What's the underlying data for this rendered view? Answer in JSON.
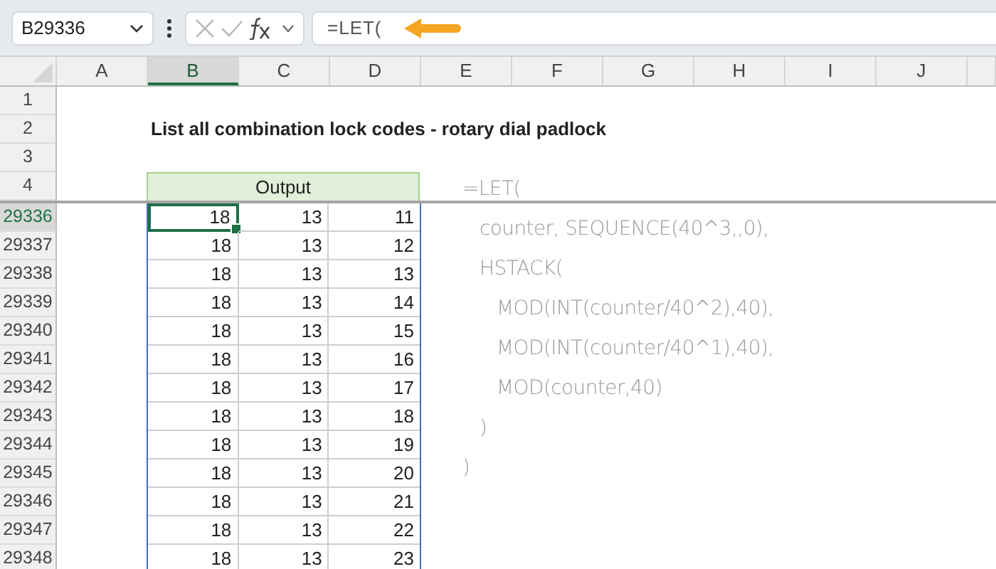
{
  "toolbar": {
    "name_box": "B29336",
    "formula": "=LET("
  },
  "columns": [
    {
      "label": "A",
      "selected": false
    },
    {
      "label": "B",
      "selected": true
    },
    {
      "label": "C",
      "selected": false
    },
    {
      "label": "D",
      "selected": false
    },
    {
      "label": "E",
      "selected": false
    },
    {
      "label": "F",
      "selected": false
    },
    {
      "label": "G",
      "selected": false
    },
    {
      "label": "H",
      "selected": false
    },
    {
      "label": "I",
      "selected": false
    },
    {
      "label": "J",
      "selected": false
    }
  ],
  "sheet_rows": [
    {
      "kind": "blank",
      "header": "1",
      "selected": false
    },
    {
      "kind": "title",
      "header": "2",
      "selected": false,
      "text": "List all combination lock codes - rotary dial padlock"
    },
    {
      "kind": "blank",
      "header": "3",
      "selected": false
    },
    {
      "kind": "header",
      "header": "4",
      "selected": false,
      "text": "Output"
    },
    {
      "kind": "data",
      "header": "29336",
      "selected": true,
      "cells": [
        {
          "text": "18",
          "selected": true
        },
        {
          "text": "13",
          "selected": false
        },
        {
          "text": "11",
          "selected": false
        }
      ]
    },
    {
      "kind": "data",
      "header": "29337",
      "selected": false,
      "cells": [
        {
          "text": "18",
          "selected": false
        },
        {
          "text": "13",
          "selected": false
        },
        {
          "text": "12",
          "selected": false
        }
      ]
    },
    {
      "kind": "data",
      "header": "29338",
      "selected": false,
      "cells": [
        {
          "text": "18",
          "selected": false
        },
        {
          "text": "13",
          "selected": false
        },
        {
          "text": "13",
          "selected": false
        }
      ]
    },
    {
      "kind": "data",
      "header": "29339",
      "selected": false,
      "cells": [
        {
          "text": "18",
          "selected": false
        },
        {
          "text": "13",
          "selected": false
        },
        {
          "text": "14",
          "selected": false
        }
      ]
    },
    {
      "kind": "data",
      "header": "29340",
      "selected": false,
      "cells": [
        {
          "text": "18",
          "selected": false
        },
        {
          "text": "13",
          "selected": false
        },
        {
          "text": "15",
          "selected": false
        }
      ]
    },
    {
      "kind": "data",
      "header": "29341",
      "selected": false,
      "cells": [
        {
          "text": "18",
          "selected": false
        },
        {
          "text": "13",
          "selected": false
        },
        {
          "text": "16",
          "selected": false
        }
      ]
    },
    {
      "kind": "data",
      "header": "29342",
      "selected": false,
      "cells": [
        {
          "text": "18",
          "selected": false
        },
        {
          "text": "13",
          "selected": false
        },
        {
          "text": "17",
          "selected": false
        }
      ]
    },
    {
      "kind": "data",
      "header": "29343",
      "selected": false,
      "cells": [
        {
          "text": "18",
          "selected": false
        },
        {
          "text": "13",
          "selected": false
        },
        {
          "text": "18",
          "selected": false
        }
      ]
    },
    {
      "kind": "data",
      "header": "29344",
      "selected": false,
      "cells": [
        {
          "text": "18",
          "selected": false
        },
        {
          "text": "13",
          "selected": false
        },
        {
          "text": "19",
          "selected": false
        }
      ]
    },
    {
      "kind": "data",
      "header": "29345",
      "selected": false,
      "cells": [
        {
          "text": "18",
          "selected": false
        },
        {
          "text": "13",
          "selected": false
        },
        {
          "text": "20",
          "selected": false
        }
      ]
    },
    {
      "kind": "data",
      "header": "29346",
      "selected": false,
      "cells": [
        {
          "text": "18",
          "selected": false
        },
        {
          "text": "13",
          "selected": false
        },
        {
          "text": "21",
          "selected": false
        }
      ]
    },
    {
      "kind": "data",
      "header": "29347",
      "selected": false,
      "cells": [
        {
          "text": "18",
          "selected": false
        },
        {
          "text": "13",
          "selected": false
        },
        {
          "text": "22",
          "selected": false
        }
      ]
    },
    {
      "kind": "data",
      "header": "29348",
      "selected": false,
      "cells": [
        {
          "text": "18",
          "selected": false
        },
        {
          "text": "13",
          "selected": false
        },
        {
          "text": "23",
          "selected": false
        }
      ]
    }
  ],
  "formula_note": [
    {
      "text": "=LET(",
      "children": [
        {
          "text": "counter, SEQUENCE(40^3,,0),"
        },
        {
          "text": "HSTACK(",
          "children": [
            {
              "text": "MOD(INT(counter/40^2),40),"
            },
            {
              "text": "MOD(INT(counter/40^1),40),"
            },
            {
              "text": "MOD(counter,40)"
            }
          ]
        },
        {
          "text": ")"
        }
      ]
    },
    {
      "text": ")"
    }
  ]
}
